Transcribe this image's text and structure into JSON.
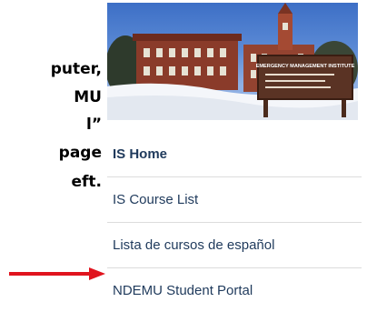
{
  "instructions": {
    "lines": [
      "puter,",
      "MU",
      "l”",
      "page",
      "eft."
    ]
  },
  "photo": {
    "sign_title": "EMERGENCY MANAGEMENT INSTITUTE"
  },
  "nav": {
    "items": [
      {
        "label": "IS Home",
        "active": true
      },
      {
        "label": "IS Course List",
        "active": false
      },
      {
        "label": "Lista de cursos de español",
        "active": false
      },
      {
        "label": "NDEMU Student Portal",
        "active": false
      }
    ]
  },
  "colors": {
    "nav_text": "#1f3a5c",
    "arrow": "#e0141e",
    "divider": "#dcdcdc"
  }
}
